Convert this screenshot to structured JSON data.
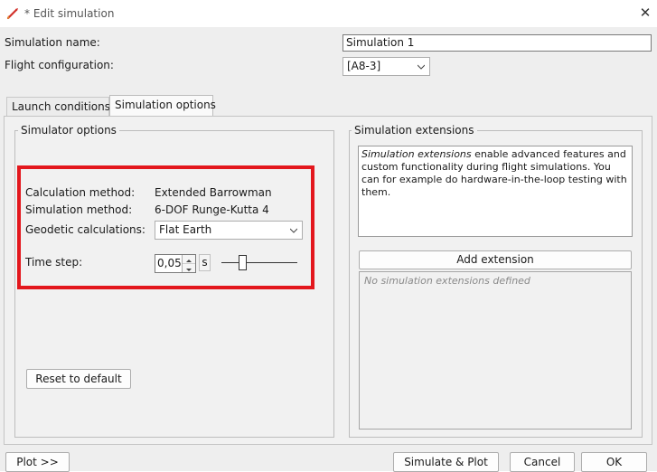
{
  "window": {
    "title": "* Edit simulation",
    "app_icon": "rocket-icon",
    "close_glyph": "✕"
  },
  "form": {
    "name_label": "Simulation name:",
    "name_value": "Simulation 1",
    "config_label": "Flight configuration:",
    "config_value": "[A8-3]"
  },
  "tabs": [
    {
      "label": "Launch conditions",
      "active": false
    },
    {
      "label": "Simulation options",
      "active": true
    }
  ],
  "simulator_options": {
    "title": "Simulator options",
    "calc_label": "Calculation method:",
    "calc_value": "Extended Barrowman",
    "sim_label": "Simulation method:",
    "sim_value": "6-DOF Runge-Kutta 4",
    "geo_label": "Geodetic calculations:",
    "geo_value": "Flat Earth",
    "timestep_label": "Time step:",
    "timestep_value": "0,05",
    "timestep_unit": "s",
    "timestep_slider_fraction": 0.25,
    "reset_label": "Reset to default",
    "highlight_color": "#e3171d"
  },
  "extensions": {
    "title": "Simulation extensions",
    "desc_em": "Simulation extensions",
    "desc_rest": " enable advanced features and custom functionality during flight simulations. You can for example do hardware-in-the-loop testing with them.",
    "add_label": "Add extension",
    "empty_text": "No simulation extensions defined"
  },
  "footer": {
    "plot_label": "Plot >>",
    "simulate_label": "Simulate & Plot",
    "cancel_label": "Cancel",
    "ok_label": "OK"
  }
}
